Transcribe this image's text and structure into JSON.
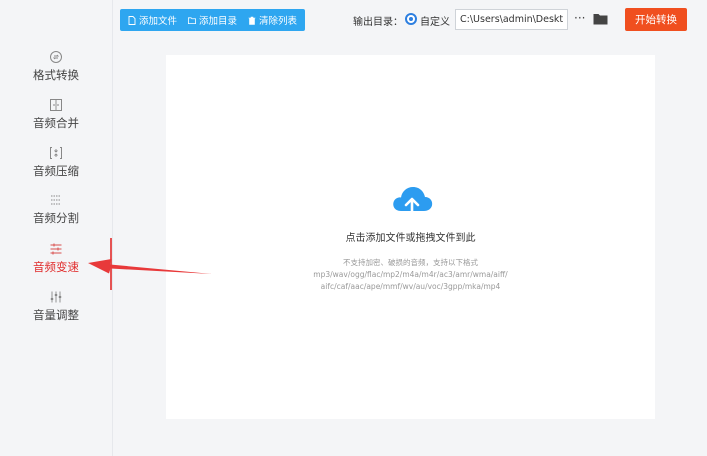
{
  "toolbar": {
    "add_file": "添加文件",
    "add_dir": "添加目录",
    "clear_list": "清除列表"
  },
  "output": {
    "label": "输出目录：",
    "option": "自定义",
    "path": "C:\\Users\\admin\\Deskto",
    "more": "···",
    "start": "开始转换"
  },
  "sidebar": {
    "items": [
      {
        "label": "格式转换",
        "icon": "format-convert-icon"
      },
      {
        "label": "音频合并",
        "icon": "audio-merge-icon"
      },
      {
        "label": "音频压缩",
        "icon": "audio-compress-icon"
      },
      {
        "label": "音频分割",
        "icon": "audio-split-icon"
      },
      {
        "label": "音频变速",
        "icon": "audio-speed-icon",
        "active": true
      },
      {
        "label": "音量调整",
        "icon": "volume-adjust-icon"
      }
    ]
  },
  "dropzone": {
    "main_text": "点击添加文件或拖拽文件到此",
    "note1": "不支持加密、破损的音频，支持以下格式",
    "note2": "mp3/wav/ogg/flac/mp2/m4a/m4r/ac3/amr/wma/aiff/",
    "note3": "aifc/caf/aac/ape/mmf/wv/au/voc/3gpp/mka/mp4"
  },
  "colors": {
    "toolbar_blue": "#2ea6f0",
    "start_orange": "#f04f1f",
    "active_red": "#e02a2a",
    "cloud_blue": "#2c9cf0"
  }
}
